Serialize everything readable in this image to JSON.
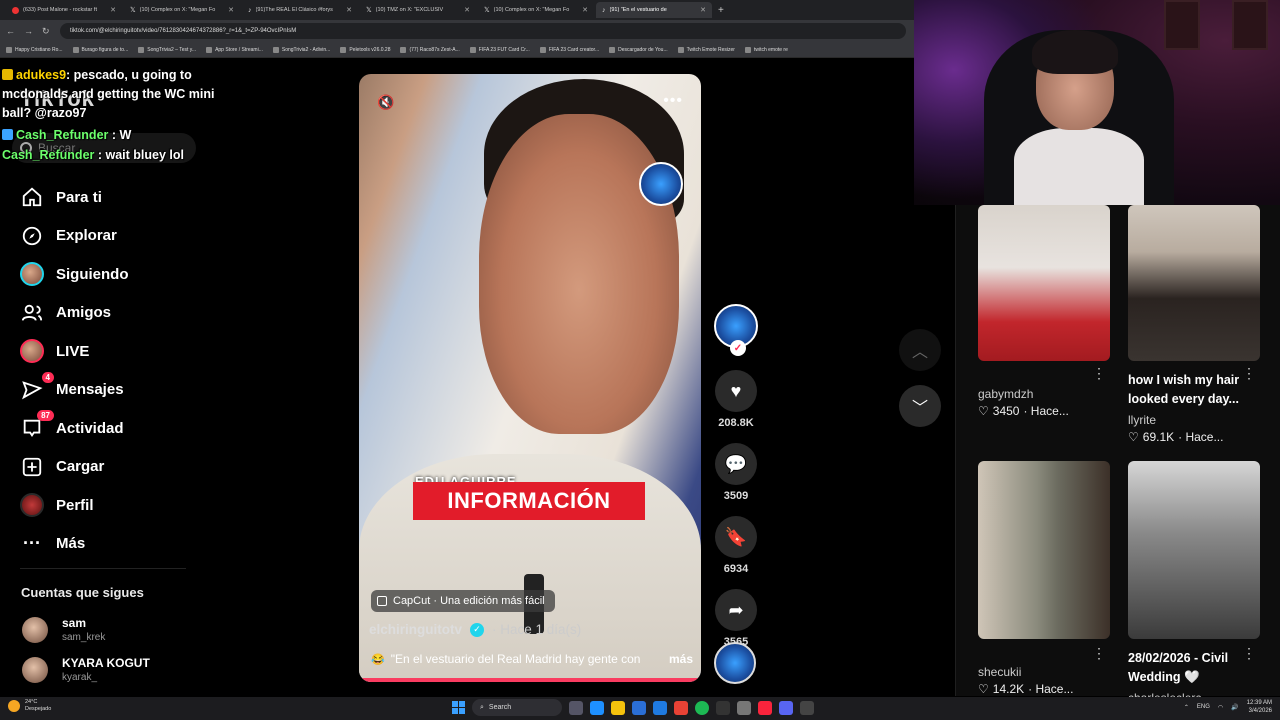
{
  "browser": {
    "tabs": [
      {
        "label": "(633) Post Malone - rockstar ft",
        "icon": "youtube-icon",
        "active": false
      },
      {
        "label": "(10) Complex on X: \"Megan Fo",
        "icon": "x-icon",
        "active": false
      },
      {
        "label": "(91)The REAL El Clásico #forys",
        "icon": "tiktok-icon",
        "active": false
      },
      {
        "label": "(10) TMZ on X: \"EXCLUSIV",
        "icon": "x-icon",
        "active": false
      },
      {
        "label": "(10) Complex on X: \"Megan Fo",
        "icon": "x-icon",
        "active": false
      },
      {
        "label": "(91) \"En el vestuario de",
        "icon": "tiktok-icon",
        "active": true
      }
    ],
    "url": "tiktok.com/@elchiringuitotv/video/7612830424674372886?_r=1&_t=ZP-94OvcIPnIsM",
    "bookmarks": [
      "Happy Cristiano Ro...",
      "Burago figura de to...",
      "SongTrivia2 – Test y...",
      "App Store / Streami...",
      "SongTrivia2 - Adivin...",
      "Peletools v26.0.28",
      "(77) Raco87s Zest-A...",
      "FIFA 23 FUT Card Cr...",
      "FIFA 23 Card creator...",
      "Descargador de You...",
      "Twitch Emote Resizer",
      "twitch emote re"
    ]
  },
  "chat": [
    {
      "user": "adukes9",
      "text": ": pescado, u going to mcdonalds and getting the WC mini ball? @razo97"
    },
    {
      "user": "Cash_Refunder",
      "text": " : W"
    },
    {
      "user": "Cash_Refunder",
      "text": " : wait bluey lol"
    }
  ],
  "sidebar": {
    "logo": "TikTok",
    "search_placeholder": "Buscar",
    "items": [
      {
        "label": "Para ti",
        "icon": "home-icon"
      },
      {
        "label": "Explorar",
        "icon": "compass-icon"
      },
      {
        "label": "Siguiendo",
        "icon": "following-avatar-icon"
      },
      {
        "label": "Amigos",
        "icon": "friends-icon"
      },
      {
        "label": "LIVE",
        "icon": "live-icon"
      },
      {
        "label": "Mensajes",
        "icon": "messages-icon",
        "badge": "4"
      },
      {
        "label": "Actividad",
        "icon": "activity-icon",
        "badge": "87"
      },
      {
        "label": "Cargar",
        "icon": "upload-icon"
      },
      {
        "label": "Perfil",
        "icon": "profile-icon"
      },
      {
        "label": "Más",
        "icon": "more-icon"
      }
    ],
    "following_title": "Cuentas que sigues",
    "accounts": [
      {
        "name": "sam",
        "handle": "sam_krek"
      },
      {
        "name": "KYARA KOGUT",
        "handle": "kyarak_"
      }
    ]
  },
  "video": {
    "overlay_name": "EDU AGUIRRE",
    "overlay_banner": "INFORMACIÓN",
    "capcut_label": "CapCut · Una edición más fácil",
    "author": "elchiringuitotv",
    "posted": "· Hace 1 día(s)",
    "description_emoji": "😂",
    "description": "\"En el vestuario del Real Madrid hay gente con",
    "more_label": "más",
    "progress": 1.0
  },
  "actions": {
    "likes": "208.8K",
    "comments": "3509",
    "saves": "6934",
    "shares": "3565"
  },
  "recommended": [
    {
      "title": "",
      "user": "gabymdzh",
      "likes": "3450",
      "time": "· Hace..."
    },
    {
      "title": "how I wish my hair looked every day...",
      "user": "llyrite",
      "likes": "69.1K",
      "time": "· Hace..."
    },
    {
      "title": "",
      "user": "shecukii",
      "likes": "14.2K",
      "time": "· Hace..."
    },
    {
      "title": "28/02/2026 - Civil Wedding 🤍",
      "user": "charlesleclerc",
      "likes": "",
      "time": ""
    }
  ],
  "taskbar": {
    "temp": "24°C",
    "weather": "Despejado",
    "search_label": "Search",
    "lang": "ENG",
    "time": "12:39 AM",
    "date": "3/4/2026"
  },
  "colors": {
    "accent": "#fe2c55",
    "banner_red": "#e21c2a",
    "verified": "#20d5ec"
  }
}
